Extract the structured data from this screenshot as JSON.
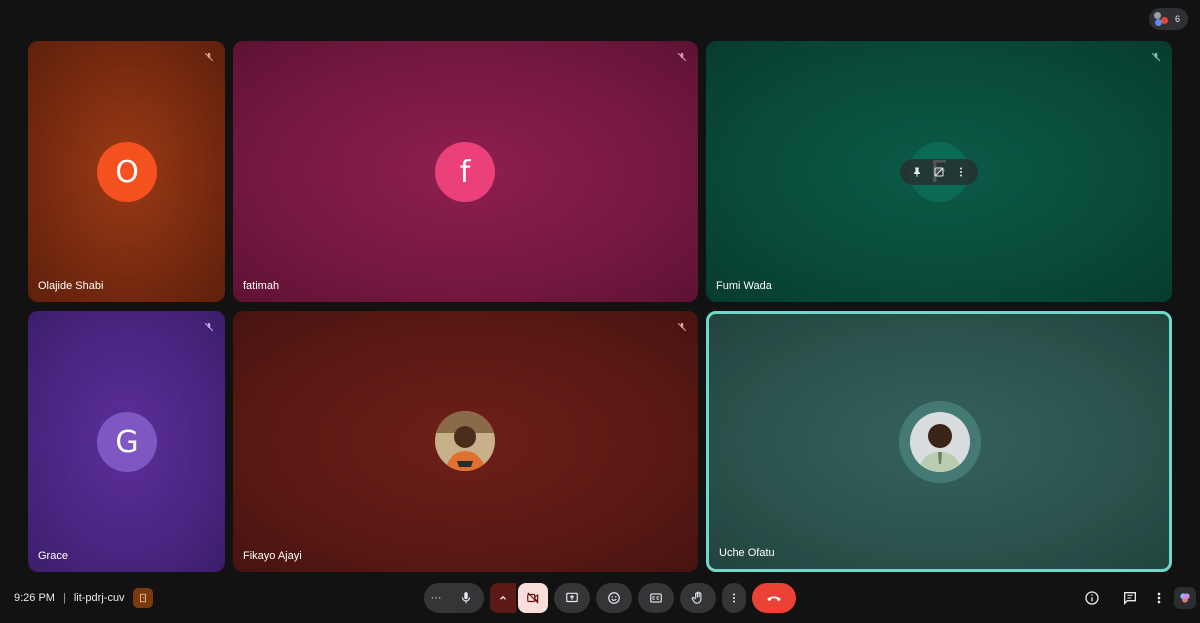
{
  "header": {
    "participant_count": "6"
  },
  "tiles": [
    {
      "name": "Olajide Shabi",
      "initial": "O",
      "avatar_color": "#f4511e",
      "muted": true
    },
    {
      "name": "fatimah",
      "initial": "f",
      "avatar_color": "#ec407a",
      "muted": true
    },
    {
      "name": "Fumi Wada",
      "initial": "F",
      "avatar_color": "#0b6b52",
      "muted": true
    },
    {
      "name": "Grace",
      "initial": "G",
      "avatar_color": "#7e57c2",
      "muted": true
    },
    {
      "name": "Fikayo Ajayi",
      "initial": "",
      "avatar_color": "#5a1914",
      "muted": true
    },
    {
      "name": "Uche Ofatu",
      "initial": "",
      "avatar_color": "#2f5c56",
      "muted": false,
      "active_speaker": true
    }
  ],
  "hover_controls": {
    "icons": [
      "pin-icon",
      "frame-icon",
      "more-vert-icon"
    ]
  },
  "footer": {
    "time": "9:26 PM",
    "separator": "|",
    "meeting_code": "lit-pdrj-cuv"
  },
  "controls": {
    "more_label": "···",
    "icons": [
      "microphone-icon",
      "chevron-up-icon",
      "camera-off-icon",
      "present-icon",
      "emoji-icon",
      "captions-icon",
      "raise-hand-icon",
      "more-vert-icon",
      "end-call-icon"
    ]
  },
  "right_controls": {
    "icons": [
      "info-icon",
      "chat-icon",
      "activities-icon",
      "gemini-icon"
    ]
  },
  "colors": {
    "accent": "#6fd8cb",
    "end_call": "#ea4335",
    "camera_off_bg": "#f9dedc"
  }
}
